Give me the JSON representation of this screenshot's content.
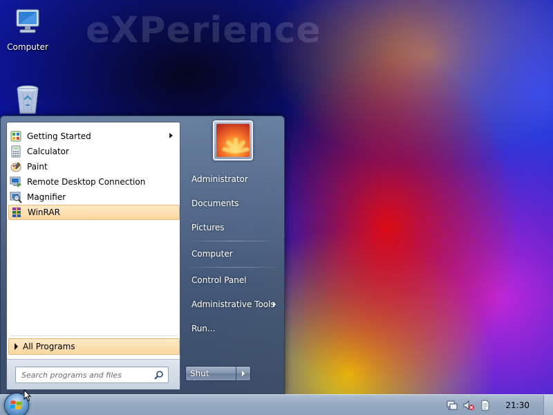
{
  "desktop": {
    "watermark": "eXPerience",
    "icons": [
      {
        "label": "Computer",
        "icon": "computer-icon"
      },
      {
        "label": "",
        "icon": "recycle-bin-icon"
      }
    ]
  },
  "start_menu": {
    "programs": [
      {
        "label": "Getting Started",
        "icon": "getting-started-icon",
        "has_submenu": true
      },
      {
        "label": "Calculator",
        "icon": "calculator-icon"
      },
      {
        "label": "Paint",
        "icon": "paint-icon"
      },
      {
        "label": "Remote Desktop Connection",
        "icon": "remote-desktop-icon"
      },
      {
        "label": "Magnifier",
        "icon": "magnifier-icon"
      },
      {
        "label": "WinRAR",
        "icon": "winrar-icon",
        "highlighted": true
      }
    ],
    "all_programs_label": "All Programs",
    "search_placeholder": "Search programs and files",
    "right_items": [
      {
        "label": "Administrator"
      },
      {
        "label": "Documents"
      },
      {
        "label": "Pictures"
      },
      {
        "label": "Computer"
      },
      {
        "label": "Control Panel"
      },
      {
        "label": "Administrative Tools",
        "has_submenu": true
      },
      {
        "label": "Run..."
      }
    ],
    "shutdown_label": "Shut down",
    "highlight_color": "#fbd7a0"
  },
  "taskbar": {
    "clock": "21:30",
    "tray_icons": [
      "action-center-icon",
      "volume-muted-icon",
      "document-icon"
    ]
  }
}
